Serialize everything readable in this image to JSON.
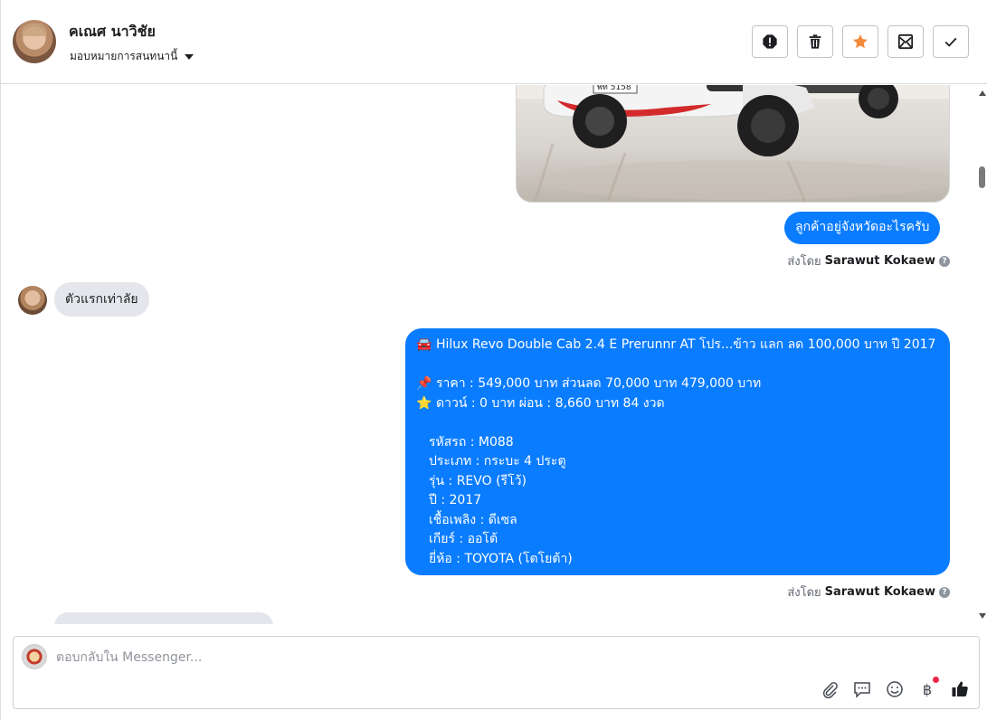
{
  "header": {
    "contact_name": "คเณศ นาวิชัย",
    "assign_label": "มอบหมายการสนทนานี้",
    "actions": [
      "spam-icon",
      "trash-icon",
      "star-icon",
      "mark-unread-icon",
      "done-icon"
    ],
    "accent": "#f5883a"
  },
  "messages": {
    "q1": "ลูกค้าอยู่จังหวัดอะไรครับ",
    "sent_prefix": "ส่งโดย",
    "sender": "Sarawut Kokaew",
    "reply1": "ตัวแรกเท่าลัย",
    "card": {
      "title": "Hilux Revo Double Cab 2.4 E Prerunnr AT โปร...ข้าว แลก ลด 100,000 บาท ปี 2017",
      "price": "ราคา : 549,000 บาท ส่วนลด 70,000 บาท 479,000 บาท",
      "down": "ดาวน์ : 0 บาท ผ่อน : 8,660 บาท 84 งวด",
      "details": [
        "รหัสรถ : M088",
        "ประเภท : กระบะ 4 ประตู",
        "รุ่น : REVO (รีโว้)",
        "ปี : 2017",
        "เชื้อเพลิง : ดีเซล",
        "เกียร์ : ออโต้",
        "ยี่ห้อ : TOYOTA (โตโยต้า)"
      ],
      "color": "#0a7cff"
    }
  },
  "composer": {
    "placeholder": "ตอบกลับใน Messenger...",
    "baht_symbol": "฿"
  }
}
